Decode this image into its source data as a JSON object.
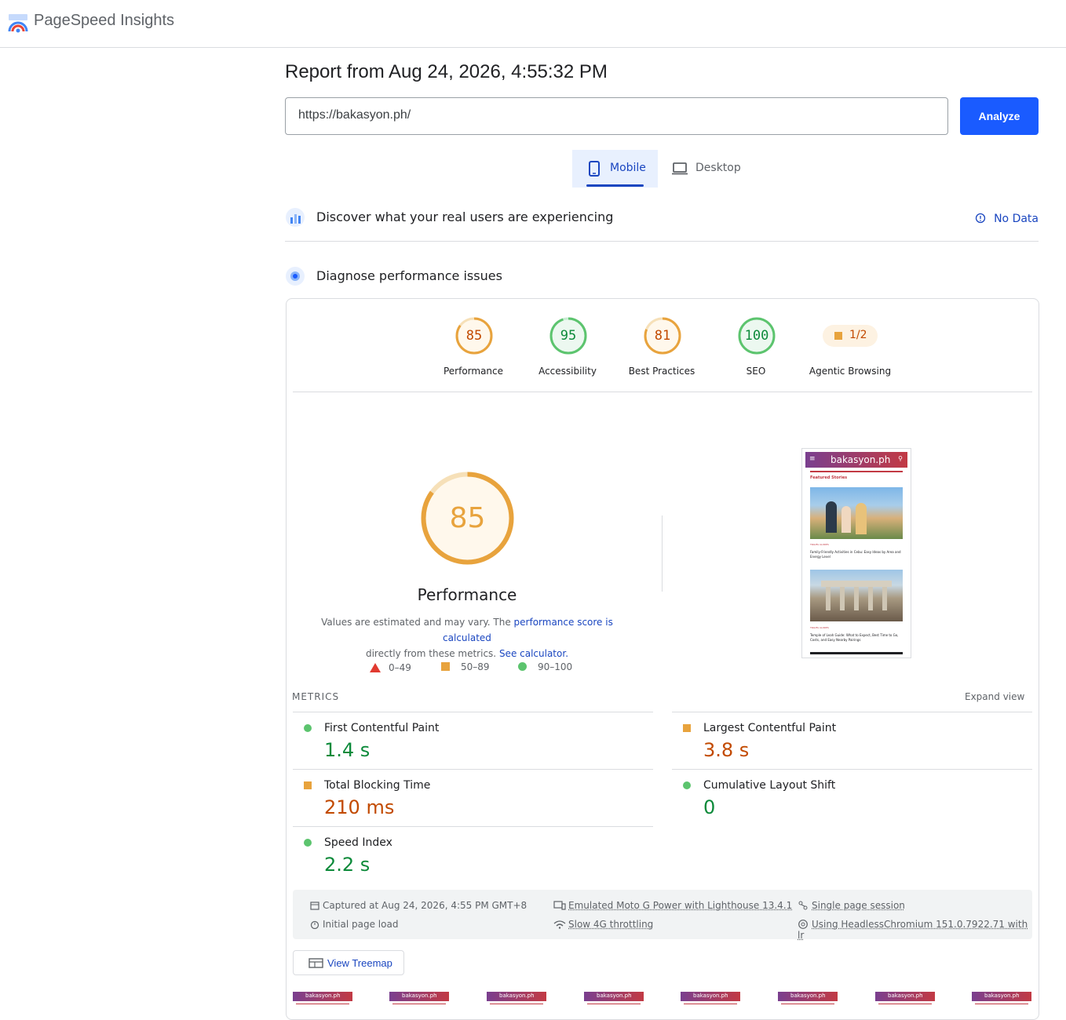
{
  "app": {
    "brand": "PageSpeed Insights"
  },
  "report": {
    "title": "Report from Aug 24, 2026, 4:55:32 PM"
  },
  "search": {
    "url": "https://bakasyon.ph/",
    "analyze_label": "Analyze"
  },
  "tabs": [
    {
      "label": "Mobile",
      "active": true
    },
    {
      "label": "Desktop",
      "active": false
    }
  ],
  "crux": {
    "title": "Discover what your real users are experiencing",
    "status": "No Data"
  },
  "diagnose": {
    "title": "Diagnose performance issues"
  },
  "categories": [
    {
      "label": "Performance",
      "score": "85",
      "color": "#e8a33d"
    },
    {
      "label": "Accessibility",
      "score": "95",
      "color": "#0c8a3a"
    },
    {
      "label": "Best Practices",
      "score": "81",
      "color": "#e8a33d"
    },
    {
      "label": "SEO",
      "score": "100",
      "color": "#0c8a3a"
    },
    {
      "label": "Agentic Browsing",
      "score": "1/2",
      "color": "#e8a33d"
    }
  ],
  "performance": {
    "score": "85",
    "title": "Performance",
    "desc_1": "Values are estimated and may vary. The ",
    "link_1": "performance score is calculated",
    "desc_2": "directly from these metrics. ",
    "link_2": "See calculator."
  },
  "legend": [
    {
      "range": "0–49"
    },
    {
      "range": "50–89"
    },
    {
      "range": "90–100"
    }
  ],
  "screenshot": {
    "site": "bakasyon.ph",
    "section": "Featured Stories",
    "tag_1": "TRAVEL GUIDES",
    "story_1": "Family-Friendly Activities in Cebu: Easy Ideas by Area and Energy Level",
    "tag_2": "TRAVEL GUIDES",
    "story_2": "Temple of Leah Guide: What to Expect, Best Time to Go, Costs, and Easy Nearby Pairings"
  },
  "metrics": {
    "heading": "METRICS",
    "expand": "Expand view",
    "items": [
      {
        "name": "First Contentful Paint",
        "value": "1.4 s",
        "status": "good"
      },
      {
        "name": "Largest Contentful Paint",
        "value": "3.8 s",
        "status": "average"
      },
      {
        "name": "Total Blocking Time",
        "value": "210 ms",
        "status": "average"
      },
      {
        "name": "Cumulative Layout Shift",
        "value": "0",
        "status": "good"
      },
      {
        "name": "Speed Index",
        "value": "2.2 s",
        "status": "good"
      }
    ]
  },
  "environment": {
    "captured": "Captured at Aug 24, 2026, 4:55 PM GMT+8",
    "load": "Initial page load",
    "device": "Emulated Moto G Power with Lighthouse 13.4.1",
    "throttle": "Slow 4G throttling",
    "session": "Single page session",
    "browser": "Using HeadlessChromium 151.0.7922.71 with lr"
  },
  "treemap": {
    "label": "View Treemap"
  },
  "filmstrip_label": "bakasyon.ph",
  "colors": {
    "good": "#0c8a3a",
    "average": "#c24a00",
    "accent": "#1a5bff",
    "link": "#1a46c0"
  }
}
